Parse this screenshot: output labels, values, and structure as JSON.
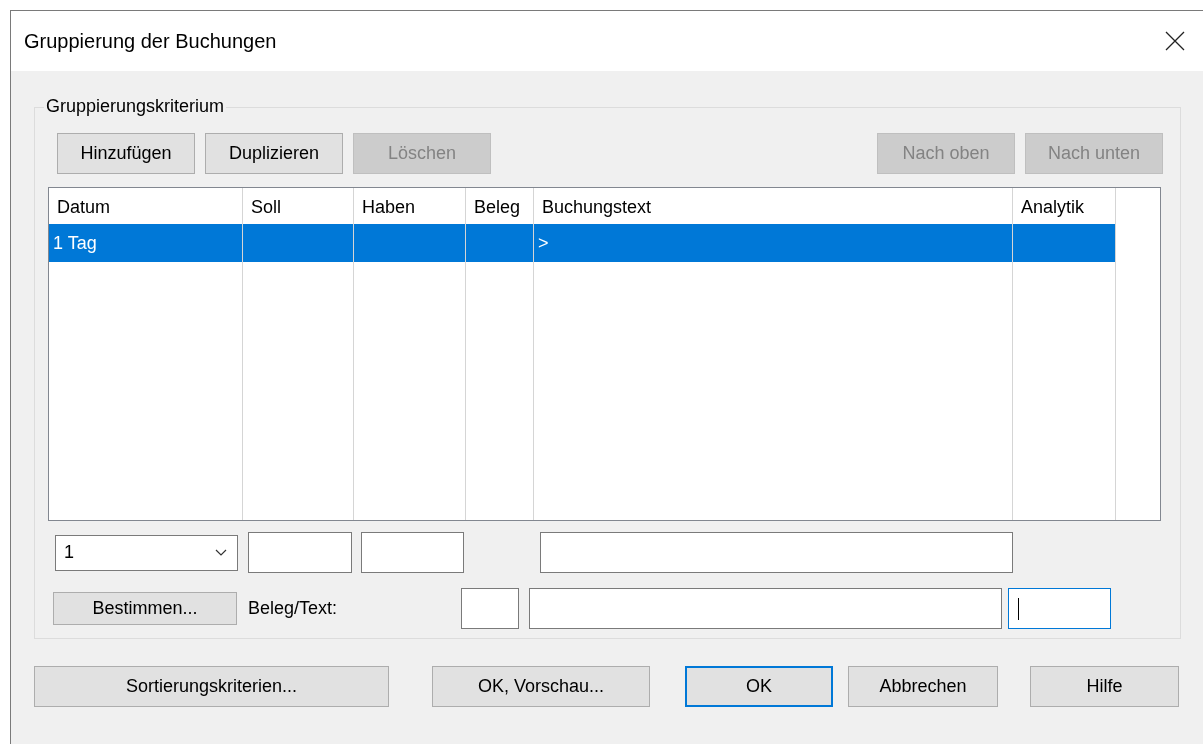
{
  "window": {
    "title": "Gruppierung der Buchungen"
  },
  "group": {
    "title": "Gruppierungskriterium",
    "toolbar_left": [
      {
        "label": "Hinzufügen",
        "disabled": false
      },
      {
        "label": "Duplizieren",
        "disabled": false
      },
      {
        "label": "Löschen",
        "disabled": true
      }
    ],
    "toolbar_right": [
      {
        "label": "Nach oben",
        "disabled": true
      },
      {
        "label": "Nach unten",
        "disabled": true
      }
    ],
    "table": {
      "columns": [
        "Datum",
        "Soll",
        "Haben",
        "Beleg",
        "Buchungstext",
        "Analytik"
      ],
      "rows": [
        {
          "selected": true,
          "cells": [
            "1 Tag",
            null,
            null,
            null,
            ">",
            null
          ]
        }
      ]
    },
    "combo": {
      "value": "1"
    },
    "row1_fields": [
      {
        "focused": false
      },
      {
        "focused": false
      },
      {
        "focused": false
      }
    ],
    "determine_button": "Bestimmen...",
    "beleg_label": "Beleg/Text:",
    "row2_fields": [
      {
        "focused": false
      },
      {
        "focused": false
      },
      {
        "focused": true
      }
    ]
  },
  "footer": [
    {
      "label": "Sortierungskriterien...",
      "default": false
    },
    {
      "label": "OK, Vorschau...",
      "default": false
    },
    {
      "label": "OK",
      "default": true
    },
    {
      "label": "Abbrechen",
      "default": false
    },
    {
      "label": "Hilfe",
      "default": false
    }
  ]
}
